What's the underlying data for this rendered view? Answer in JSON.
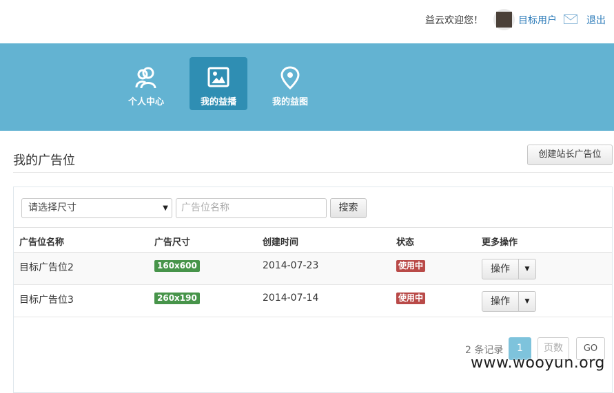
{
  "header": {
    "welcome": "益云欢迎您！",
    "username": "目标用户",
    "mail_icon": "mail-icon",
    "logout": "退出"
  },
  "nav": {
    "items": [
      {
        "label": "个人中心",
        "icon": "users-icon",
        "active": false
      },
      {
        "label": "我的益播",
        "icon": "image-icon",
        "active": true
      },
      {
        "label": "我的益图",
        "icon": "location-pin-icon",
        "active": false
      }
    ]
  },
  "page": {
    "title": "我的广告位",
    "create_button": "创建站长广告位"
  },
  "filters": {
    "size_select_value": "请选择尺寸",
    "name_placeholder": "广告位名称",
    "search_button": "搜索"
  },
  "table": {
    "columns": [
      "广告位名称",
      "广告尺寸",
      "创建时间",
      "状态",
      "更多操作"
    ],
    "rows": [
      {
        "name": "目标广告位2",
        "size": "160x600",
        "created": "2014-07-23",
        "status": "使用中",
        "action": "操作"
      },
      {
        "name": "目标广告位3",
        "size": "260x190",
        "created": "2014-07-14",
        "status": "使用中",
        "action": "操作"
      }
    ]
  },
  "pagination": {
    "count_text": "2 条记录",
    "current_page": "1",
    "page_input_placeholder": "页数",
    "go_label": "GO"
  },
  "watermark": "www.wooyun.org",
  "colors": {
    "nav_band": "#63b3d2",
    "nav_active": "#2f8eb3",
    "link": "#2a7ab8",
    "size_badge": "#47944a",
    "status_badge": "#b94a48",
    "page_active": "#7ec3dc"
  }
}
